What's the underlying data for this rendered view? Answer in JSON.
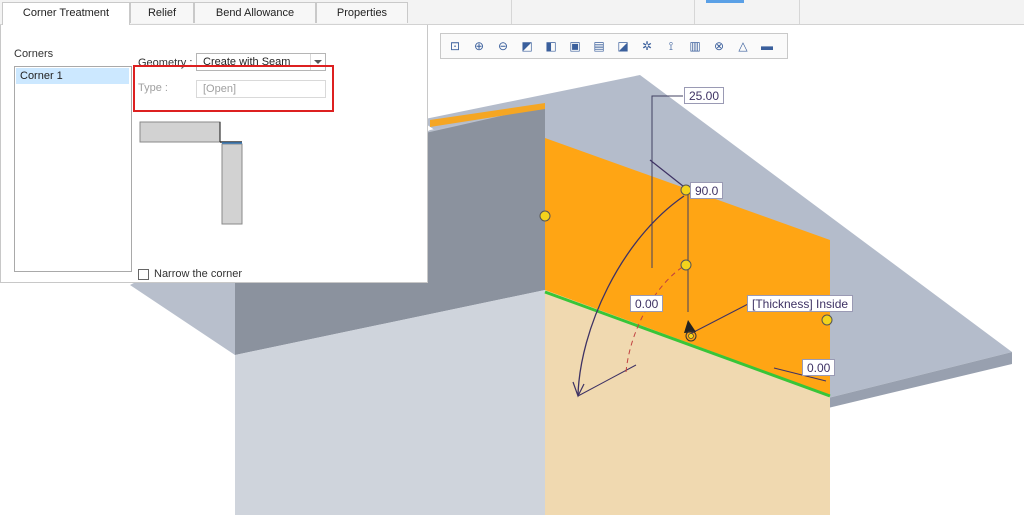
{
  "tabs": [
    {
      "label": "Corner Treatment",
      "active": true
    },
    {
      "label": "Relief",
      "active": false
    },
    {
      "label": "Bend Allowance",
      "active": false
    },
    {
      "label": "Properties",
      "active": false
    }
  ],
  "panel": {
    "corners_label": "Corners",
    "corners": [
      "Corner 1"
    ],
    "geometry_label": "Geometry :",
    "geometry_value": "Create with Seam",
    "type_label": "Type :",
    "type_value": "[Open]",
    "narrow_label": "Narrow the corner",
    "narrow_checked": false
  },
  "toolbar_icons": [
    "zoom-window-icon",
    "zoom-in-icon",
    "zoom-out-icon",
    "shaded-display-icon",
    "view-orientation-icon",
    "saved-views-icon",
    "display-style-icon",
    "section-icon",
    "datum-display-icon",
    "axis-display-icon",
    "annotation-display-icon",
    "spin-center-icon",
    "appearance-icon",
    "render-icon"
  ],
  "dimensions": {
    "length": "25.00",
    "angle": "90.0",
    "offset": "0.00",
    "thickness": "[Thickness] Inside",
    "offset2": "0.00"
  },
  "colors": {
    "orange": "#ffa514",
    "selected_edge": "#38c538",
    "highlight": "#dd2020",
    "sheet_gray": "#b4bccb",
    "list_selection": "#cce8ff"
  }
}
